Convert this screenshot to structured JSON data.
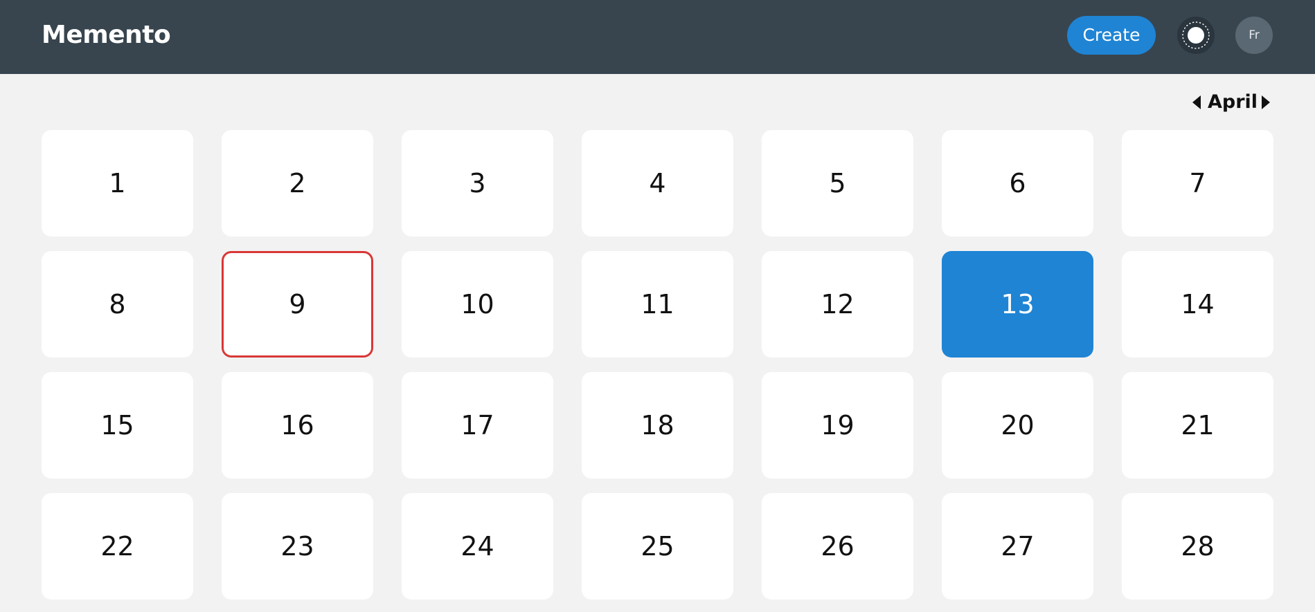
{
  "header": {
    "brand": "Memento",
    "create_label": "Create",
    "theme_icon": "sun-icon",
    "lang_label": "Fr"
  },
  "calendar": {
    "month": "April",
    "today_day": "9",
    "selected_day": "13",
    "colors": {
      "header_bg": "#38454f",
      "accent": "#1f84d4",
      "today_border": "#d93636",
      "page_bg": "#f2f2f2"
    },
    "days": [
      "1",
      "2",
      "3",
      "4",
      "5",
      "6",
      "7",
      "8",
      "9",
      "10",
      "11",
      "12",
      "13",
      "14",
      "15",
      "16",
      "17",
      "18",
      "19",
      "20",
      "21",
      "22",
      "23",
      "24",
      "25",
      "26",
      "27",
      "28"
    ]
  }
}
